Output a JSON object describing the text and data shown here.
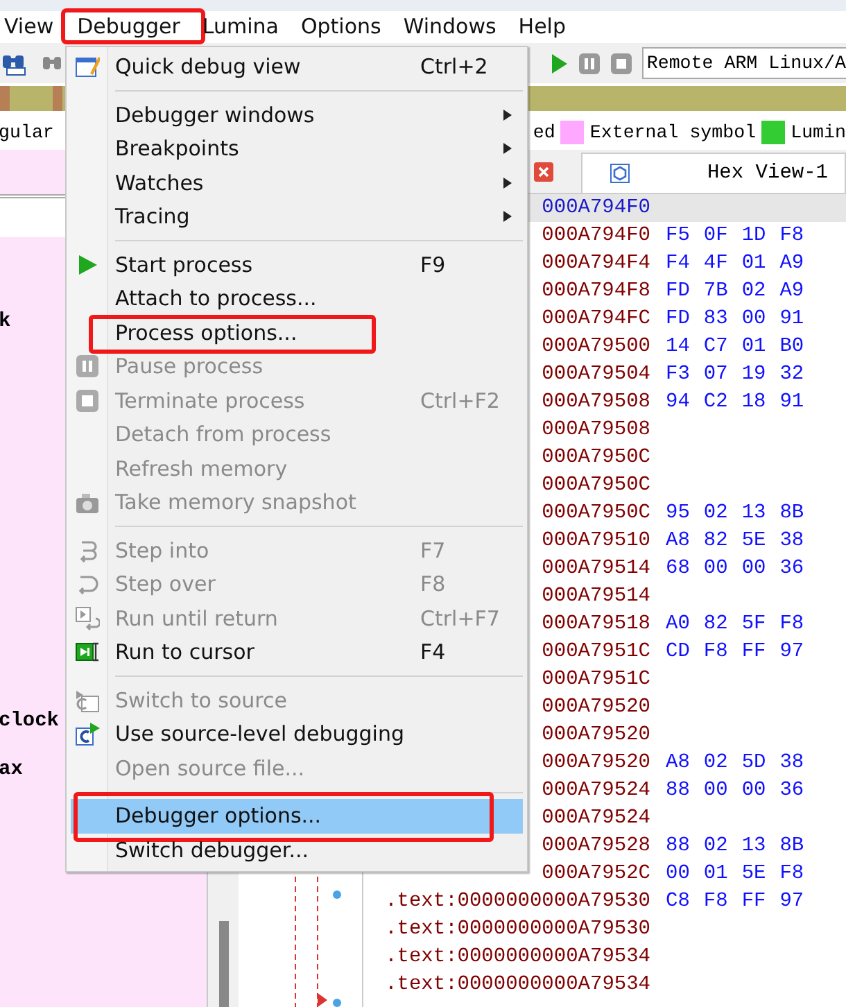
{
  "menubar": [
    {
      "label": "View",
      "annotated": false
    },
    {
      "label": "Debugger",
      "annotated": true
    },
    {
      "label": "Lumina",
      "annotated": false
    },
    {
      "label": "Options",
      "annotated": false
    },
    {
      "label": "Windows",
      "annotated": false
    },
    {
      "label": "Help",
      "annotated": false
    }
  ],
  "toolbar": {
    "debugger_target": "Remote ARM Linux/A"
  },
  "legend": {
    "left_fragment": "gular",
    "right_fragment": "ed",
    "items": [
      {
        "label": "External symbol",
        "color": "#ffa8ff"
      },
      {
        "label": "Lumin",
        "color": "#33cc33"
      }
    ]
  },
  "tabs": [
    {
      "label": "Hex View-1"
    }
  ],
  "left_pane": {
    "lines": [
      "k",
      "clock",
      "ax"
    ]
  },
  "listing": [
    {
      "address": "000A794F0",
      "selected": true
    },
    {
      "address": "000A794F0",
      "bytes": [
        "F5",
        "0F",
        "1D",
        "F8"
      ],
      "selected": false
    },
    {
      "address": "000A794F4",
      "bytes": [
        "F4",
        "4F",
        "01",
        "A9"
      ],
      "selected": false
    },
    {
      "address": "000A794F8",
      "bytes": [
        "FD",
        "7B",
        "02",
        "A9"
      ],
      "selected": false
    },
    {
      "address": "000A794FC",
      "bytes": [
        "FD",
        "83",
        "00",
        "91"
      ],
      "selected": false
    },
    {
      "address": "000A79500",
      "bytes": [
        "14",
        "C7",
        "01",
        "B0"
      ],
      "selected": false
    },
    {
      "address": "000A79504",
      "bytes": [
        "F3",
        "07",
        "19",
        "32"
      ],
      "selected": false
    },
    {
      "address": "000A79508",
      "bytes": [
        "94",
        "C2",
        "18",
        "91"
      ],
      "selected": false
    },
    {
      "address": "000A79508",
      "selected": false
    },
    {
      "address": "000A7950C",
      "selected": false
    },
    {
      "address": "000A7950C",
      "selected": false
    },
    {
      "address": "000A7950C",
      "bytes": [
        "95",
        "02",
        "13",
        "8B"
      ],
      "selected": false
    },
    {
      "address": "000A79510",
      "bytes": [
        "A8",
        "82",
        "5E",
        "38"
      ],
      "selected": false
    },
    {
      "address": "000A79514",
      "bytes": [
        "68",
        "00",
        "00",
        "36"
      ],
      "selected": false
    },
    {
      "address": "000A79514",
      "selected": false
    },
    {
      "address": "000A79518",
      "bytes": [
        "A0",
        "82",
        "5F",
        "F8"
      ],
      "selected": false
    },
    {
      "address": "000A7951C",
      "bytes": [
        "CD",
        "F8",
        "FF",
        "97"
      ],
      "selected": false
    },
    {
      "address": "000A7951C",
      "selected": false
    },
    {
      "address": "000A79520",
      "selected": false
    },
    {
      "address": "000A79520",
      "selected": false
    },
    {
      "address": "000A79520",
      "bytes": [
        "A8",
        "02",
        "5D",
        "38"
      ],
      "selected": false
    },
    {
      "address": "000A79524",
      "bytes": [
        "88",
        "00",
        "00",
        "36"
      ],
      "selected": false
    },
    {
      "address": "000A79524",
      "selected": false
    },
    {
      "address": "000A79528",
      "bytes": [
        "88",
        "02",
        "13",
        "8B"
      ],
      "selected": false
    },
    {
      "address": "000A7952C",
      "bytes": [
        "00",
        "01",
        "5E",
        "F8"
      ],
      "selected": false
    },
    {
      "address": ".text:0000000000A79530",
      "bytes": [
        "C8",
        "F8",
        "FF",
        "97"
      ],
      "selected": false
    },
    {
      "address": ".text:0000000000A79530",
      "selected": false
    },
    {
      "address": ".text:0000000000A79534",
      "selected": false
    },
    {
      "address": ".text:0000000000A79534",
      "selected": false
    }
  ],
  "menu": [
    {
      "kind": "item",
      "label": "Quick debug view",
      "shortcut": "Ctrl+2",
      "submenu": false,
      "disabled": false,
      "highlighted": false,
      "annotated": false
    },
    {
      "kind": "separator"
    },
    {
      "kind": "item",
      "label": "Debugger windows",
      "submenu": true,
      "disabled": false,
      "highlighted": false,
      "annotated": false
    },
    {
      "kind": "item",
      "label": "Breakpoints",
      "submenu": true,
      "disabled": false,
      "highlighted": false,
      "annotated": false
    },
    {
      "kind": "item",
      "label": "Watches",
      "submenu": true,
      "disabled": false,
      "highlighted": false,
      "annotated": false
    },
    {
      "kind": "item",
      "label": "Tracing",
      "submenu": true,
      "disabled": false,
      "highlighted": false,
      "annotated": false
    },
    {
      "kind": "separator"
    },
    {
      "kind": "item",
      "label": "Start process",
      "shortcut": "F9",
      "submenu": false,
      "disabled": false,
      "highlighted": false,
      "annotated": false
    },
    {
      "kind": "item",
      "label": "Attach to process...",
      "submenu": false,
      "disabled": false,
      "highlighted": false,
      "annotated": false
    },
    {
      "kind": "item",
      "label": "Process options...",
      "submenu": false,
      "disabled": false,
      "highlighted": false,
      "annotated": true
    },
    {
      "kind": "item",
      "label": "Pause process",
      "submenu": false,
      "disabled": true,
      "highlighted": false,
      "annotated": false
    },
    {
      "kind": "item",
      "label": "Terminate process",
      "shortcut": "Ctrl+F2",
      "submenu": false,
      "disabled": true,
      "highlighted": false,
      "annotated": false
    },
    {
      "kind": "item",
      "label": "Detach from process",
      "submenu": false,
      "disabled": true,
      "highlighted": false,
      "annotated": false
    },
    {
      "kind": "item",
      "label": "Refresh memory",
      "submenu": false,
      "disabled": true,
      "highlighted": false,
      "annotated": false
    },
    {
      "kind": "item",
      "label": "Take memory snapshot",
      "submenu": false,
      "disabled": true,
      "highlighted": false,
      "annotated": false
    },
    {
      "kind": "separator"
    },
    {
      "kind": "item",
      "label": "Step into",
      "shortcut": "F7",
      "submenu": false,
      "disabled": true,
      "highlighted": false,
      "annotated": false
    },
    {
      "kind": "item",
      "label": "Step over",
      "shortcut": "F8",
      "submenu": false,
      "disabled": true,
      "highlighted": false,
      "annotated": false
    },
    {
      "kind": "item",
      "label": "Run until return",
      "shortcut": "Ctrl+F7",
      "submenu": false,
      "disabled": true,
      "highlighted": false,
      "annotated": false
    },
    {
      "kind": "item",
      "label": "Run to cursor",
      "shortcut": "F4",
      "submenu": false,
      "disabled": false,
      "highlighted": false,
      "annotated": false
    },
    {
      "kind": "separator"
    },
    {
      "kind": "item",
      "label": "Switch to source",
      "submenu": false,
      "disabled": true,
      "highlighted": false,
      "annotated": false
    },
    {
      "kind": "item",
      "label": "Use source-level debugging",
      "submenu": false,
      "disabled": false,
      "highlighted": false,
      "annotated": false
    },
    {
      "kind": "item",
      "label": "Open source file...",
      "submenu": false,
      "disabled": true,
      "highlighted": false,
      "annotated": false
    },
    {
      "kind": "separator"
    },
    {
      "kind": "item",
      "label": "Debugger options...",
      "submenu": false,
      "disabled": false,
      "highlighted": true,
      "annotated": true
    },
    {
      "kind": "item",
      "label": "Switch debugger...",
      "submenu": false,
      "disabled": false,
      "highlighted": false,
      "annotated": false
    }
  ]
}
